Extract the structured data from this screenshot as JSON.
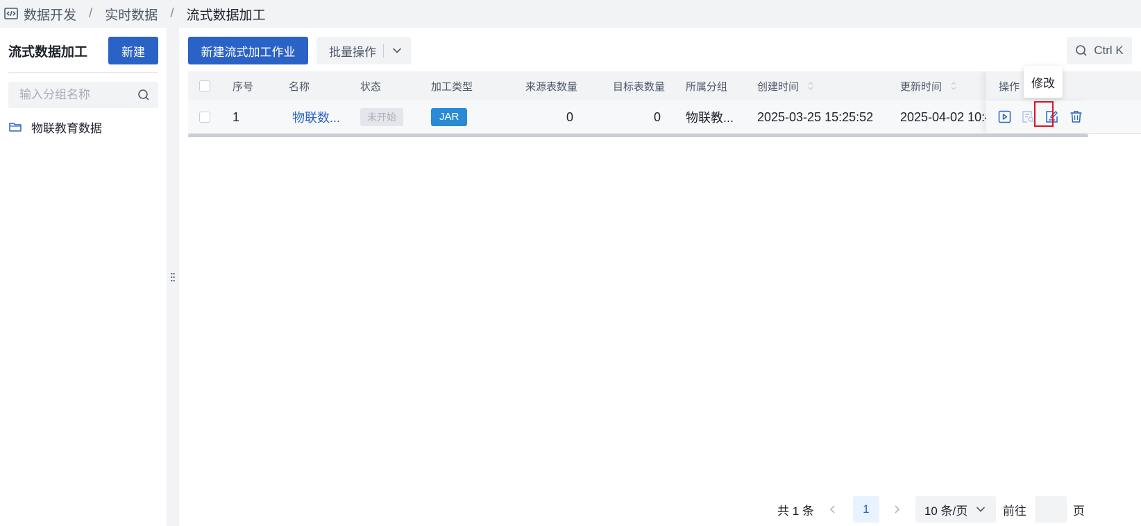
{
  "breadcrumb": {
    "items": [
      "数据开发",
      "实时数据",
      "流式数据加工"
    ],
    "separator": "/"
  },
  "sidebar": {
    "title": "流式数据加工",
    "new_button": "新建",
    "search_placeholder": "输入分组名称",
    "groups": [
      "物联教育数据"
    ]
  },
  "toolbar": {
    "create_job_button": "新建流式加工作业",
    "batch_button": "批量操作",
    "search_shortcut": "Ctrl K"
  },
  "table": {
    "columns": {
      "index": "序号",
      "name": "名称",
      "status": "状态",
      "process_type": "加工类型",
      "source_count": "来源表数量",
      "target_count": "目标表数量",
      "group": "所属分组",
      "created_at": "创建时间",
      "updated_at": "更新时间",
      "actions": "操作"
    },
    "rows": [
      {
        "index": "1",
        "name": "物联数...",
        "status": "未开始",
        "process_type": "JAR",
        "source_count": "0",
        "target_count": "0",
        "group": "物联教...",
        "created_at": "2025-03-25 15:25:52",
        "updated_at": "2025-04-02 10:4"
      }
    ],
    "action_icons": [
      "run-icon",
      "view-log-icon",
      "edit-icon",
      "delete-icon"
    ]
  },
  "tooltip": {
    "text": "修改"
  },
  "pagination": {
    "total": "共 1 条",
    "current_page": "1",
    "page_size": "10 条/页",
    "goto_label": "前往",
    "goto_value": "",
    "page_suffix": "页"
  },
  "colors": {
    "primary": "#2a62c6",
    "tag_blue": "#2a8ad6",
    "highlight_red": "#e0121d"
  }
}
